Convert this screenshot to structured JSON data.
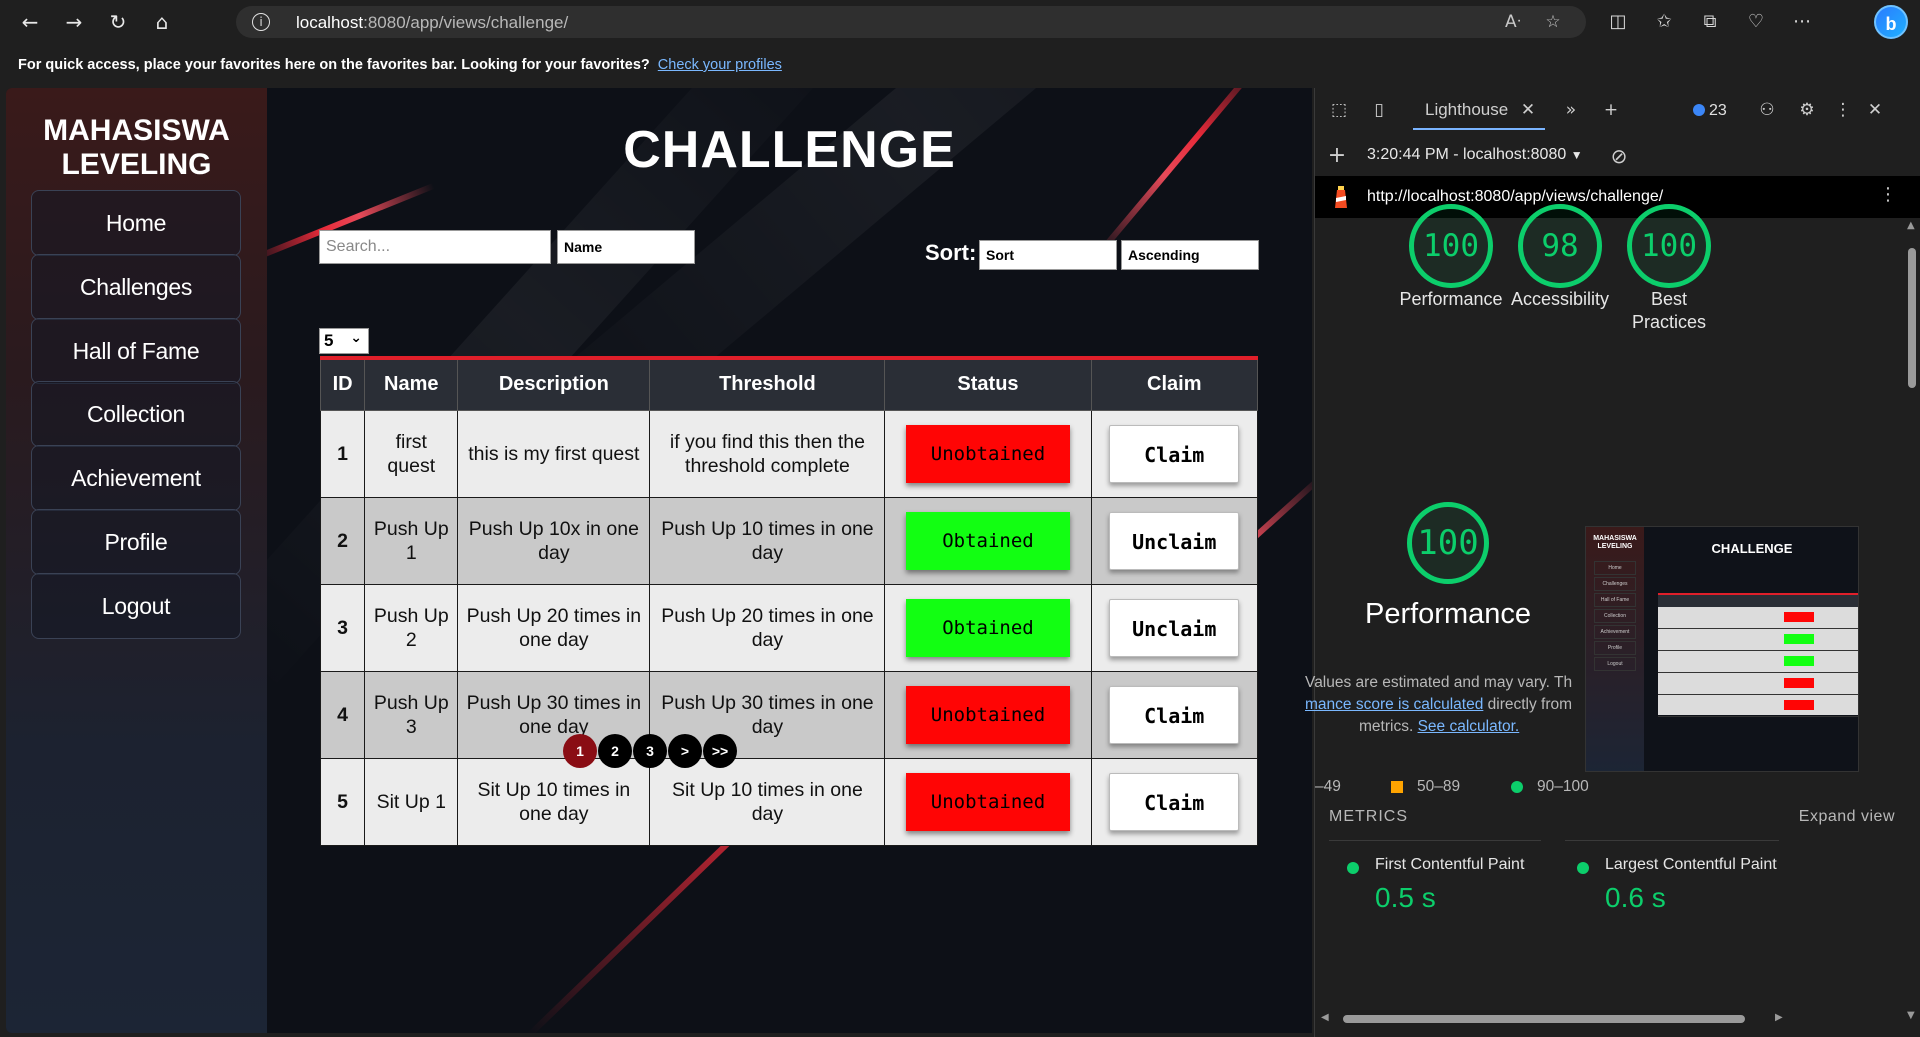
{
  "browser": {
    "url_host": "localhost",
    "url_rest": ":8080/app/views/challenge/",
    "favbar_text": "For quick access, place your favorites here on the favorites bar. Looking for your favorites?",
    "favbar_link": "Check your profiles",
    "icons": [
      "back-icon",
      "forward-icon",
      "refresh-icon",
      "home-icon",
      "info-icon",
      "read-aloud-icon",
      "add-favorite-icon",
      "split-screen-icon",
      "favorites-icon",
      "collections-icon",
      "performance-icon",
      "more-icon",
      "copilot-icon"
    ]
  },
  "app": {
    "brand": "MAHASISWA\nLEVELING",
    "nav": [
      "Home",
      "Challenges",
      "Hall of Fame",
      "Collection",
      "Achievement",
      "Profile",
      "Logout"
    ],
    "title": "CHALLENGE",
    "search_placeholder": "Search...",
    "filter_value": "Name",
    "sort_label": "Sort:",
    "sort_value": "Sort",
    "order_value": "Ascending",
    "page_size": "5",
    "table": {
      "headers": [
        "ID",
        "Name",
        "Description",
        "Threshold",
        "Status",
        "Claim"
      ],
      "rows": [
        {
          "id": "1",
          "name": "first quest",
          "description": "this is my first quest",
          "threshold": "if you find this then the threshold complete",
          "status": "Unobtained",
          "claim": "Claim"
        },
        {
          "id": "2",
          "name": "Push Up 1",
          "description": "Push Up 10x in one day",
          "threshold": "Push Up 10 times in one day",
          "status": "Obtained",
          "claim": "Unclaim"
        },
        {
          "id": "3",
          "name": "Push Up 2",
          "description": "Push Up 20 times in one day",
          "threshold": "Push Up 20 times in one day",
          "status": "Obtained",
          "claim": "Unclaim"
        },
        {
          "id": "4",
          "name": "Push Up 3",
          "description": "Push Up 30 times in one day",
          "threshold": "Push Up 30 times in one day",
          "status": "Unobtained",
          "claim": "Claim"
        },
        {
          "id": "5",
          "name": "Sit Up 1",
          "description": "Sit Up 10 times in one day",
          "threshold": "Sit Up 10 times in one day",
          "status": "Unobtained",
          "claim": "Claim"
        }
      ]
    },
    "pagination": [
      "1",
      "2",
      "3",
      ">",
      ">>"
    ],
    "colors": {
      "accent_red": "#e01f2a",
      "status_red": "#ff0505",
      "status_green": "#12ff12",
      "active_page": "#8a0d14"
    }
  },
  "devtools": {
    "tab": "Lighthouse",
    "issues_count": "23",
    "report_time": "3:20:44 PM - localhost:8080",
    "report_url": "http://localhost:8080/app/views/challenge/",
    "scores": [
      {
        "value": "100",
        "label": "Performance"
      },
      {
        "value": "98",
        "label": "Accessibility"
      },
      {
        "value": "100",
        "label": "Best\nPractices"
      }
    ],
    "perf_score": "100",
    "perf_label": "Performance",
    "note_line1": "Values are estimated and may vary. Th",
    "note_line2_link": "mance score is calculated",
    "note_line2_rest": " directly from",
    "note_line3": "metrics.",
    "note_link2": "See calculator.",
    "legend": {
      "fail": "–49",
      "average": "50–89",
      "pass": "90–100"
    },
    "metrics_title": "METRICS",
    "expand_view": "Expand view",
    "metrics": [
      {
        "name": "First Contentful Paint",
        "value": "0.5 s"
      },
      {
        "name": "Largest Contentful Paint",
        "value": "0.6 s"
      }
    ],
    "thumb": {
      "brand": "MAHASISWA LEVELING",
      "title": "CHALLENGE",
      "nav": [
        "Home",
        "Challenges",
        "Hall of Fame",
        "Collection",
        "Achievement",
        "Profile",
        "Logout"
      ]
    },
    "colors": {
      "pass": "#0cce6b",
      "average": "#ffa400"
    }
  }
}
